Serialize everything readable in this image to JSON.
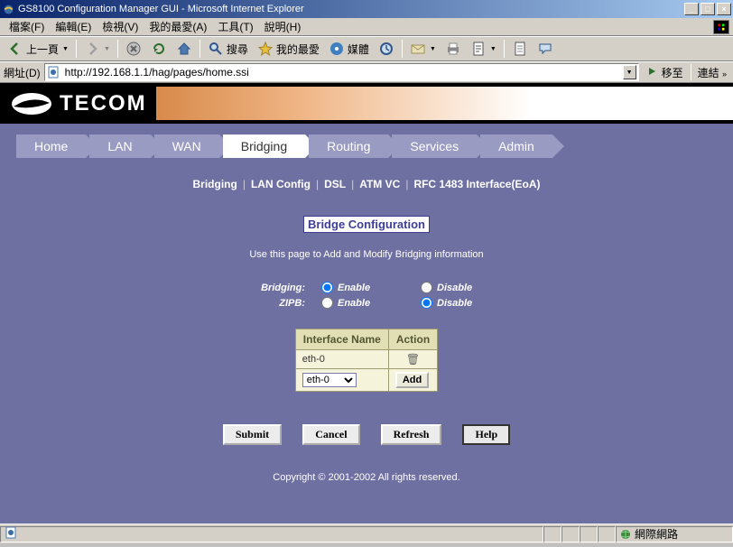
{
  "window": {
    "title": "GS8100 Configuration Manager GUI - Microsoft Internet Explorer"
  },
  "menu": {
    "file": "檔案(F)",
    "edit": "編輯(E)",
    "view": "檢視(V)",
    "favorites": "我的最愛(A)",
    "tools": "工具(T)",
    "help": "說明(H)"
  },
  "toolbar": {
    "back": "上一頁",
    "search": "搜尋",
    "favorites": "我的最愛",
    "media": "媒體"
  },
  "addressbar": {
    "label": "網址(D)",
    "url": "http://192.168.1.1/hag/pages/home.ssi",
    "go": "移至",
    "links": "連結"
  },
  "brand": {
    "name": "TECOM"
  },
  "tabs": [
    "Home",
    "LAN",
    "WAN",
    "Bridging",
    "Routing",
    "Services",
    "Admin"
  ],
  "active_tab_index": 3,
  "subnav": [
    "Bridging",
    "LAN Config",
    "DSL",
    "ATM VC",
    "RFC 1483 Interface(EoA)"
  ],
  "section": {
    "title": "Bridge Configuration",
    "desc": "Use this page to Add and Modify Bridging information"
  },
  "options": {
    "bridging_label": "Bridging:",
    "zipb_label": "ZIPB:",
    "enable": "Enable",
    "disable": "Disable",
    "bridging_value": "Enable",
    "zipb_value": "Disable"
  },
  "table": {
    "col_interface": "Interface Name",
    "col_action": "Action",
    "rows": [
      {
        "name": "eth-0"
      }
    ],
    "select_options": [
      "eth-0"
    ],
    "selected": "eth-0",
    "add": "Add"
  },
  "buttons": {
    "submit": "Submit",
    "cancel": "Cancel",
    "refresh": "Refresh",
    "help": "Help"
  },
  "copyright": "Copyright © 2001-2002 All rights reserved.",
  "statusbar": {
    "zone": "網際網路"
  }
}
